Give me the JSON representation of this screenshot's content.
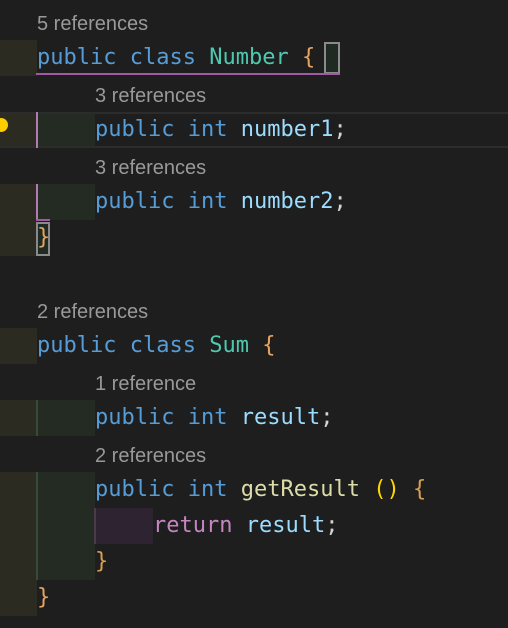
{
  "editor": {
    "classes": [
      {
        "references": "5 references",
        "keyword_public": "public",
        "keyword_class": "class",
        "name": "Number",
        "open_brace": "{",
        "close_brace": "}",
        "members": [
          {
            "references": "3 references",
            "modifier": "public",
            "type": "int",
            "name": "number1",
            "terminator": ";"
          },
          {
            "references": "3 references",
            "modifier": "public",
            "type": "int",
            "name": "number2",
            "terminator": ";"
          }
        ]
      },
      {
        "references": "2 references",
        "keyword_public": "public",
        "keyword_class": "class",
        "name": "Sum",
        "open_brace": "{",
        "close_brace": "}",
        "field": {
          "references": "1 reference",
          "modifier": "public",
          "type": "int",
          "name": "result",
          "terminator": ";"
        },
        "method": {
          "references": "2 references",
          "modifier": "public",
          "type": "int",
          "name": "getResult",
          "params": "()",
          "open_brace": "{",
          "return_keyword": "return",
          "return_value": "result",
          "terminator": ";",
          "close_brace": "}"
        }
      }
    ],
    "lightbulb_icon": "lightbulb-icon"
  }
}
